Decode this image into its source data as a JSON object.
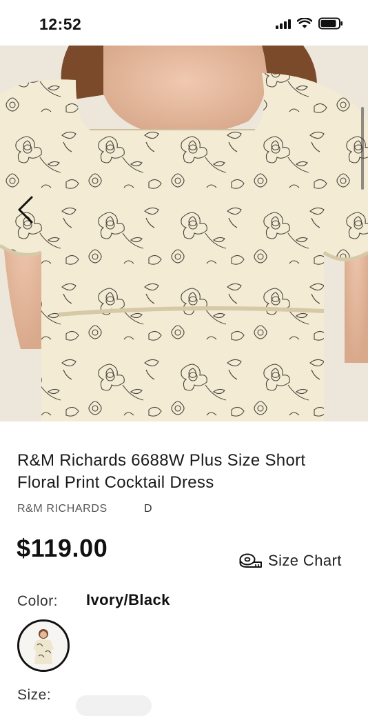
{
  "status_bar": {
    "time": "12:52",
    "icons": [
      "signal-icon",
      "wifi-icon",
      "battery-icon"
    ]
  },
  "hero": {
    "image": "floral-dress-photo",
    "back_icon": "chevron-left-icon"
  },
  "product": {
    "title": "R&M Richards 6688W Plus Size Short Floral Print Cocktail Dress",
    "brand": "R&M RICHARDS",
    "brand_extra": "D",
    "price": "$119.00",
    "size_chart_label": "Size Chart",
    "size_chart_icon": "measuring-tape-icon"
  },
  "color": {
    "label": "Color:",
    "value": "Ivory/Black"
  },
  "size": {
    "label": "Size:"
  }
}
